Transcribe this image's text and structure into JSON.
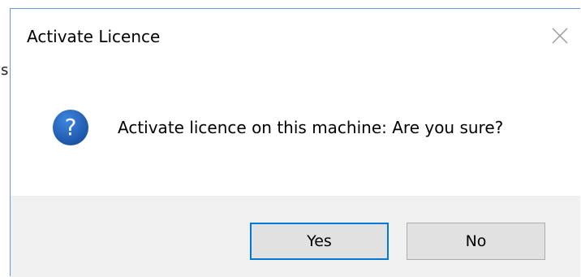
{
  "backdrop": {
    "glyph": "s"
  },
  "dialog": {
    "title": "Activate Licence",
    "close_icon": "close-icon",
    "message": "Activate licence on this machine: Are you sure?",
    "icon": "question-icon",
    "buttons": {
      "yes_label": "Yes",
      "no_label": "No"
    }
  },
  "colors": {
    "accent_border": "#0078d7",
    "icon_blue": "#1f5fb8",
    "footer_bg": "#f0f0f0",
    "button_bg": "#e1e1e1"
  }
}
